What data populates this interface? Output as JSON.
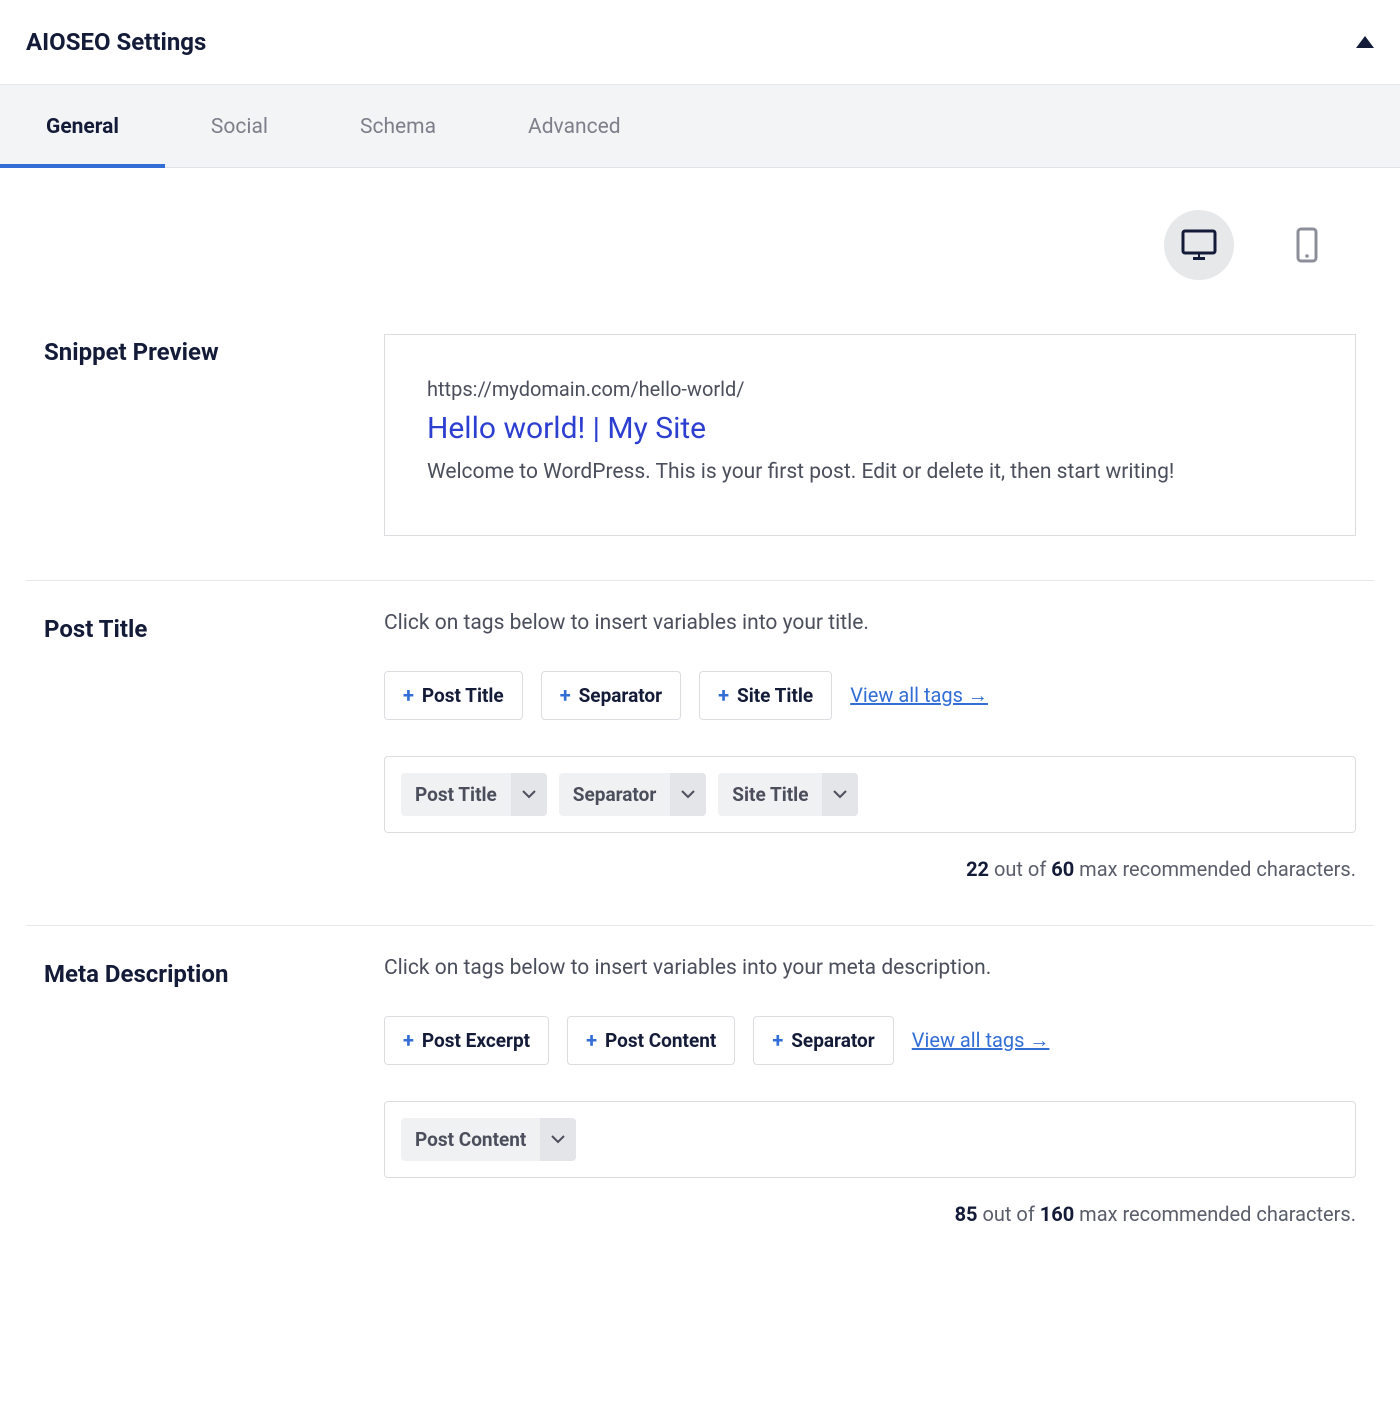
{
  "panel": {
    "title": "AIOSEO Settings"
  },
  "tabs": [
    {
      "label": "General",
      "active": true
    },
    {
      "label": "Social",
      "active": false
    },
    {
      "label": "Schema",
      "active": false
    },
    {
      "label": "Advanced",
      "active": false
    }
  ],
  "snippet_preview": {
    "heading": "Snippet Preview",
    "url": "https://mydomain.com/hello-world/",
    "title": "Hello world! | My Site",
    "description": "Welcome to WordPress. This is your first post. Edit or delete it, then start writing!"
  },
  "post_title": {
    "heading": "Post Title",
    "helper": "Click on tags below to insert variables into your title.",
    "suggested_tags": [
      "Post Title",
      "Separator",
      "Site Title"
    ],
    "view_all": "View all tags →",
    "chips": [
      "Post Title",
      "Separator",
      "Site Title"
    ],
    "char_current": "22",
    "char_max": "60",
    "char_label_out_of": " out of ",
    "char_label_suffix": " max recommended characters."
  },
  "meta_description": {
    "heading": "Meta Description",
    "helper": "Click on tags below to insert variables into your meta description.",
    "suggested_tags": [
      "Post Excerpt",
      "Post Content",
      "Separator"
    ],
    "view_all": "View all tags →",
    "chips": [
      "Post Content"
    ],
    "char_current": "85",
    "char_max": "160",
    "char_label_out_of": " out of ",
    "char_label_suffix": " max recommended characters."
  }
}
